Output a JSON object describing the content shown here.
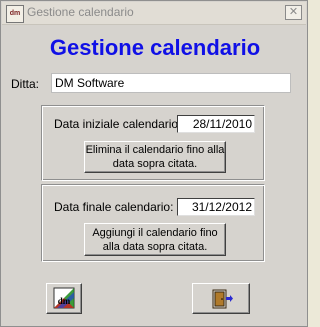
{
  "window": {
    "app_icon_text": "dm",
    "title": "Gestione calendario",
    "close_glyph": "✕"
  },
  "heading": "Gestione calendario",
  "company": {
    "label": "Ditta:",
    "value": "DM Software"
  },
  "start_section": {
    "label": "Data iniziale calendario:",
    "date": "28/11/2010",
    "button_line1": "Elimina il calendario fino alla",
    "button_line2": "data sopra citata."
  },
  "end_section": {
    "label": "Data finale calendario:",
    "date": "31/12/2012",
    "button_line1": "Aggiungi  il calendario fino",
    "button_line2": "alla data sopra citata."
  },
  "toolbar": {
    "logo_icon": "dm-logo-icon",
    "exit_icon": "exit-door-icon"
  }
}
